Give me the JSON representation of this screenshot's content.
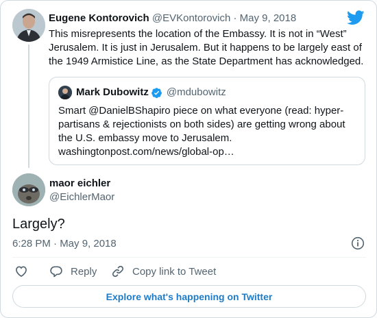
{
  "brand_color": "#1d9bf0",
  "parent_tweet": {
    "author_name": "Eugene Kontorovich",
    "meta": " @EVKontorovich · May 9, 2018",
    "text": "This misrepresents the location of the Embassy. It is not in “West” Jerusalem. It is just in Jerusalem. But it happens to be largely east of the 1949 Armistice Line, as the State Department has acknowledged.",
    "quoted_tweet": {
      "author_name": "Mark Dubowitz",
      "author_handle": "@mdubowitz",
      "text": "Smart @DanielBShapiro piece on what everyone (read: hyper-partisans & rejectionists on both sides) are getting wrong about the U.S. embassy move to Jerusalem. washingtonpost.com/news/global-op…"
    }
  },
  "main_tweet": {
    "author_name": "maor eichler",
    "author_handle": "@EichlerMaor",
    "text": "Largely?",
    "timestamp": "6:28 PM · May 9, 2018"
  },
  "actions": {
    "reply_label": "Reply",
    "copy_link_label": "Copy link to Tweet"
  },
  "explore_label": "Explore what's happening on Twitter"
}
